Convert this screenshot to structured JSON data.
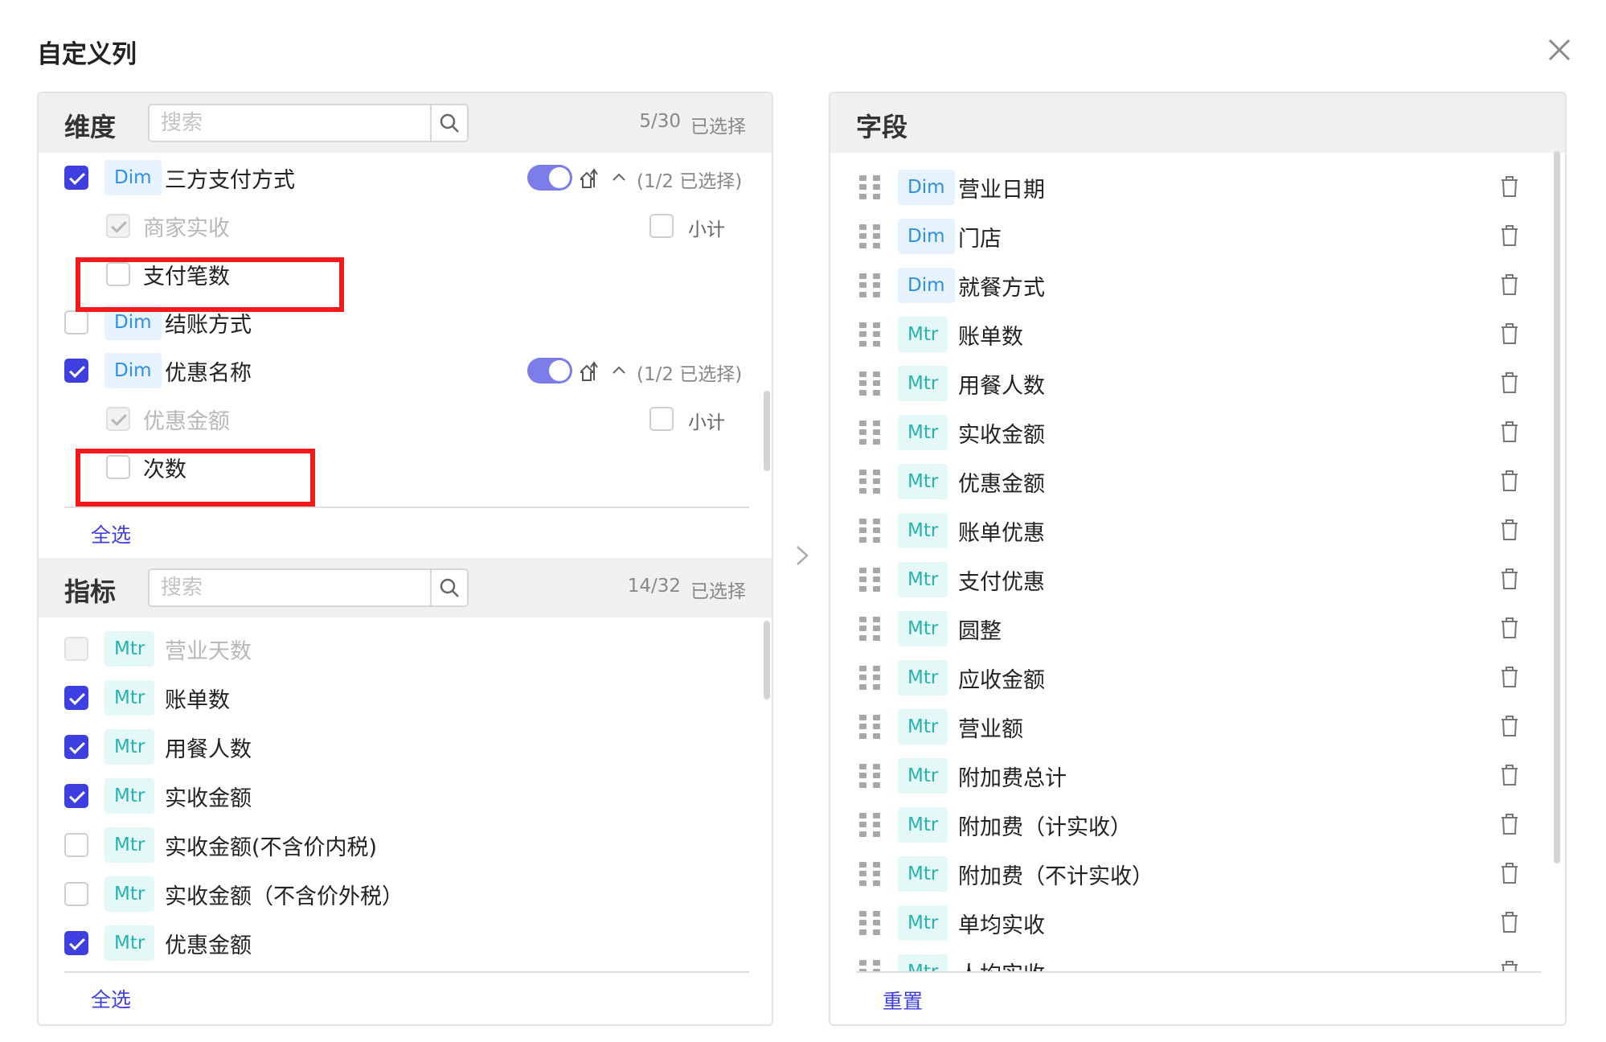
{
  "dialog": {
    "title": "自定义列"
  },
  "dimensions": {
    "title": "维度",
    "search_placeholder": "搜索",
    "count": "5/30",
    "selected_suffix": "已选择",
    "select_all": "全选",
    "rows": [
      {
        "type": "parent",
        "checked": true,
        "tag": "Dim",
        "label": "三方支付方式",
        "toggle_on": true,
        "sub_selected": "(1/2 已选择)"
      },
      {
        "type": "child",
        "state": "disabled-checked",
        "label": "商家实收",
        "subtotal": "小计"
      },
      {
        "type": "child",
        "state": "unchecked",
        "label": "支付笔数",
        "highlight": true
      },
      {
        "type": "parent",
        "checked": false,
        "tag": "Dim",
        "label": "结账方式"
      },
      {
        "type": "parent",
        "checked": true,
        "tag": "Dim",
        "label": "优惠名称",
        "toggle_on": true,
        "sub_selected": "(1/2 已选择)"
      },
      {
        "type": "child",
        "state": "disabled-checked",
        "label": "优惠金额",
        "subtotal": "小计"
      },
      {
        "type": "child",
        "state": "unchecked",
        "label": "次数",
        "highlight": true
      }
    ]
  },
  "metrics": {
    "title": "指标",
    "search_placeholder": "搜索",
    "count": "14/32",
    "selected_suffix": "已选择",
    "select_all": "全选",
    "rows": [
      {
        "state": "disabled",
        "tag": "Mtr",
        "label": "营业天数"
      },
      {
        "state": "checked",
        "tag": "Mtr",
        "label": "账单数"
      },
      {
        "state": "checked",
        "tag": "Mtr",
        "label": "用餐人数"
      },
      {
        "state": "checked",
        "tag": "Mtr",
        "label": "实收金额"
      },
      {
        "state": "unchecked",
        "tag": "Mtr",
        "label": "实收金额(不含价内税)"
      },
      {
        "state": "unchecked",
        "tag": "Mtr",
        "label": "实收金额（不含价外税）"
      },
      {
        "state": "checked",
        "tag": "Mtr",
        "label": "优惠金额"
      }
    ]
  },
  "fields": {
    "title": "字段",
    "reset": "重置",
    "items": [
      {
        "tag": "Dim",
        "label": "营业日期"
      },
      {
        "tag": "Dim",
        "label": "门店"
      },
      {
        "tag": "Dim",
        "label": "就餐方式"
      },
      {
        "tag": "Mtr",
        "label": "账单数"
      },
      {
        "tag": "Mtr",
        "label": "用餐人数"
      },
      {
        "tag": "Mtr",
        "label": "实收金额"
      },
      {
        "tag": "Mtr",
        "label": "优惠金额"
      },
      {
        "tag": "Mtr",
        "label": "账单优惠"
      },
      {
        "tag": "Mtr",
        "label": "支付优惠"
      },
      {
        "tag": "Mtr",
        "label": "圆整"
      },
      {
        "tag": "Mtr",
        "label": "应收金额"
      },
      {
        "tag": "Mtr",
        "label": "营业额"
      },
      {
        "tag": "Mtr",
        "label": "附加费总计"
      },
      {
        "tag": "Mtr",
        "label": "附加费（计实收）"
      },
      {
        "tag": "Mtr",
        "label": "附加费（不计实收）"
      },
      {
        "tag": "Mtr",
        "label": "单均实收"
      },
      {
        "tag": "Mtr",
        "label": "人均实收"
      }
    ]
  },
  "colors": {
    "accent": "#3d3fe0",
    "toggle": "#7b7de9",
    "highlight": "#f21a1a",
    "dim_tag_text": "#2f8fe4",
    "mtr_tag_text": "#27b3ad"
  },
  "icons": {
    "close": "close-icon",
    "search": "search-icon",
    "sort": "sort-icon",
    "chevron_up": "chevron-up-icon",
    "drag": "drag-handle-icon",
    "trash": "trash-icon",
    "transfer": "chevron-right-icon"
  }
}
